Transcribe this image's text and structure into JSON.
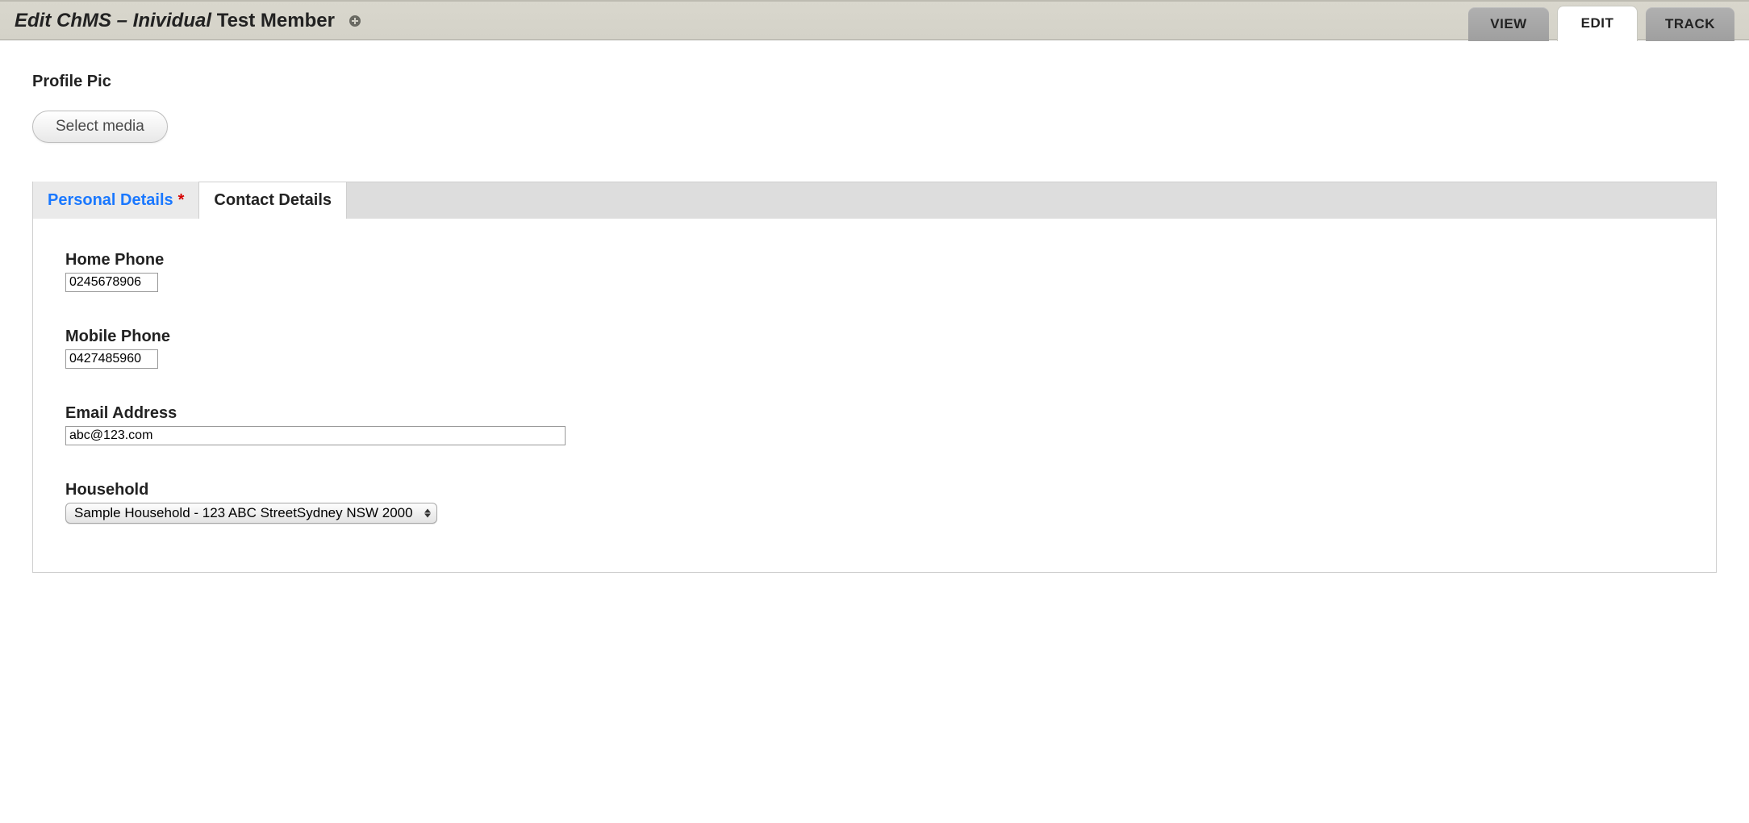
{
  "header": {
    "title_italic": "Edit ChMS – Inividual",
    "title_rest": " Test Member",
    "tabs": [
      {
        "label": "VIEW",
        "state": "inactive"
      },
      {
        "label": "EDIT",
        "state": "active"
      },
      {
        "label": "TRACK",
        "state": "inactive"
      }
    ]
  },
  "profile_pic": {
    "heading": "Profile Pic",
    "select_media_label": "Select media"
  },
  "inner_tabs": [
    {
      "label": "Personal Details",
      "state": "inactive",
      "required": true
    },
    {
      "label": "Contact Details",
      "state": "active",
      "required": false
    }
  ],
  "fields": {
    "home_phone": {
      "label": "Home Phone",
      "value": "0245678906"
    },
    "mobile_phone": {
      "label": "Mobile Phone",
      "value": "0427485960"
    },
    "email": {
      "label": "Email Address",
      "value": "abc@123.com"
    },
    "household": {
      "label": "Household",
      "selected": "Sample Household - 123 ABC StreetSydney NSW 2000"
    }
  }
}
